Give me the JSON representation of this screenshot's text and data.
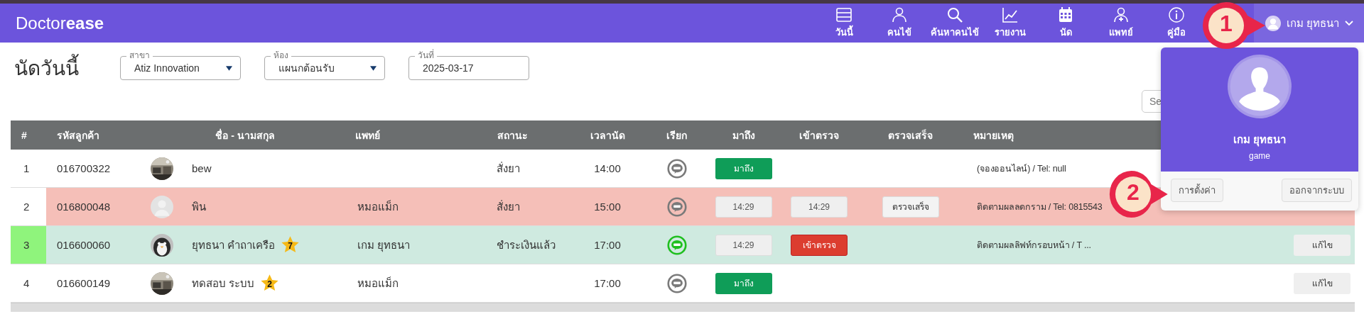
{
  "logo": "Doctor**ease**",
  "nav": [
    {
      "label": "วันนี้"
    },
    {
      "label": "คนไข้"
    },
    {
      "label": "ค้นหาคนไข้"
    },
    {
      "label": "รายงาน"
    },
    {
      "label": "นัด"
    },
    {
      "label": "แพทย์"
    },
    {
      "label": "คู่มือ"
    }
  ],
  "user_menu": {
    "name": "เกม ยุทธนา",
    "expanded": true
  },
  "page_title": "นัดวันนี้",
  "filters": [
    {
      "label": "สาขา",
      "value": "Atiz Innovation",
      "kind": "select"
    },
    {
      "label": "ห้อง",
      "value": "แผนกต้อนรับ",
      "kind": "select"
    },
    {
      "label": "วันที่",
      "value": "2025-03-17",
      "kind": "text"
    }
  ],
  "search": {
    "placeholder": "Se"
  },
  "table": {
    "columns": [
      "#",
      "รหัสลูกค้า",
      "ชื่อ - นามสกุล",
      "แพทย์",
      "สถานะ",
      "เวลานัด",
      "เรียก",
      "มาถึง",
      "เข้าตรวจ",
      "ตรวจเสร็จ",
      "หมายเหตุ"
    ],
    "rows": [
      {
        "number": "1",
        "code": "016700322",
        "has_photo": true,
        "name": "bew",
        "doctor": "",
        "status": "สั่งยา",
        "time": "14:00",
        "line_active": false,
        "color": "#ffffff",
        "number_highlight": false,
        "arrived": {
          "kind": "button",
          "label": "มาถึง"
        },
        "note": "(จองออนไลน์) / Tel: null"
      },
      {
        "number": "2",
        "code": "016800048",
        "has_photo": false,
        "name": "พิน",
        "doctor": "หมอแม็ก",
        "status": "สั่งยา",
        "time": "15:00",
        "line_active": false,
        "color": "#f5bfb8",
        "number_highlight": false,
        "arrived": {
          "kind": "time",
          "label": "14:29"
        },
        "checkin": {
          "kind": "time",
          "label": "14:29"
        },
        "done": {
          "kind": "button",
          "label": "ตรวจเสร็จ"
        },
        "note": "ติดตามผลลดกราม / Tel: 0815543"
      },
      {
        "number": "3",
        "code": "016600060",
        "has_photo": true,
        "name": "ยุทธนา คำถาเครือ",
        "star": "7",
        "doctor": "เกม ยุทธนา",
        "status": "ชำระเงินแล้ว",
        "time": "17:00",
        "line_active": true,
        "color": "#cfeae0",
        "number_highlight": true,
        "arrived": {
          "kind": "time",
          "label": "14:29"
        },
        "checkin": {
          "kind": "button",
          "label": "เข้าตรวจ"
        },
        "note": "ติดตามผลลิฟท์กรอบหน้า / T ...",
        "edit": "แก้ไข"
      },
      {
        "number": "4",
        "code": "016600149",
        "has_photo": true,
        "name": "ทดสอบ ระบบ",
        "star": "2",
        "doctor": "หมอแม็ก",
        "status": "",
        "time": "17:00",
        "line_active": false,
        "color": "#ffffff",
        "number_highlight": false,
        "arrived": {
          "kind": "button",
          "label": "มาถึง"
        },
        "note": "",
        "edit": "แก้ไข"
      }
    ]
  },
  "dropdown": {
    "name": "เกม ยุทธนา",
    "username": "game",
    "buttons": [
      "การตั้งค่า",
      "ออกจากระบบ"
    ]
  },
  "callouts": [
    {
      "label": "1"
    },
    {
      "label": "2"
    }
  ]
}
